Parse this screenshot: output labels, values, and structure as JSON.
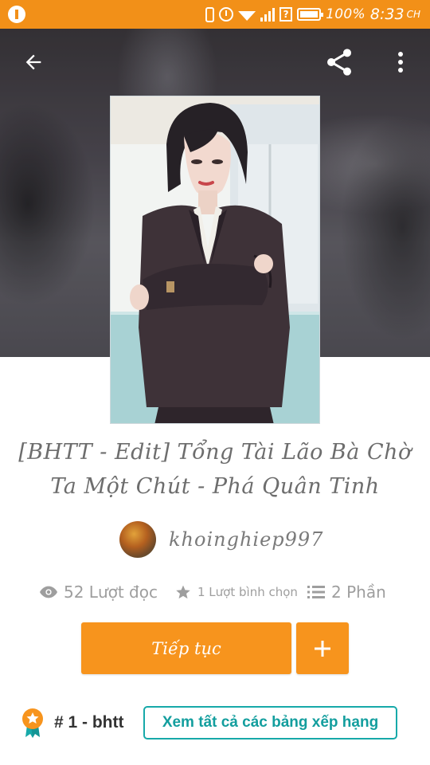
{
  "status_bar": {
    "battery": "100%",
    "time": "8:33",
    "period": "CH"
  },
  "toolbar": {
    "back_icon": "arrow-left-icon",
    "share_icon": "share-icon",
    "more_icon": "more-vertical-icon"
  },
  "story": {
    "title": "[BHTT - Edit] Tổng Tài Lão Bà Chờ Ta Một Chút - Phá Quân Tinh",
    "author": "khoinghiep997",
    "stats": {
      "reads": "52 Lượt đọc",
      "votes": "1 Lượt bình chọn",
      "parts": "2 Phần"
    }
  },
  "actions": {
    "continue_label": "Tiếp tục",
    "add_label": "+"
  },
  "ranking": {
    "rank_text": "# 1 - bhtt",
    "view_all_label": "Xem tất cả các bảng xếp hạng"
  },
  "colors": {
    "accent": "#f7941d",
    "status_bar": "#f29018",
    "teal": "#17a9a9"
  }
}
